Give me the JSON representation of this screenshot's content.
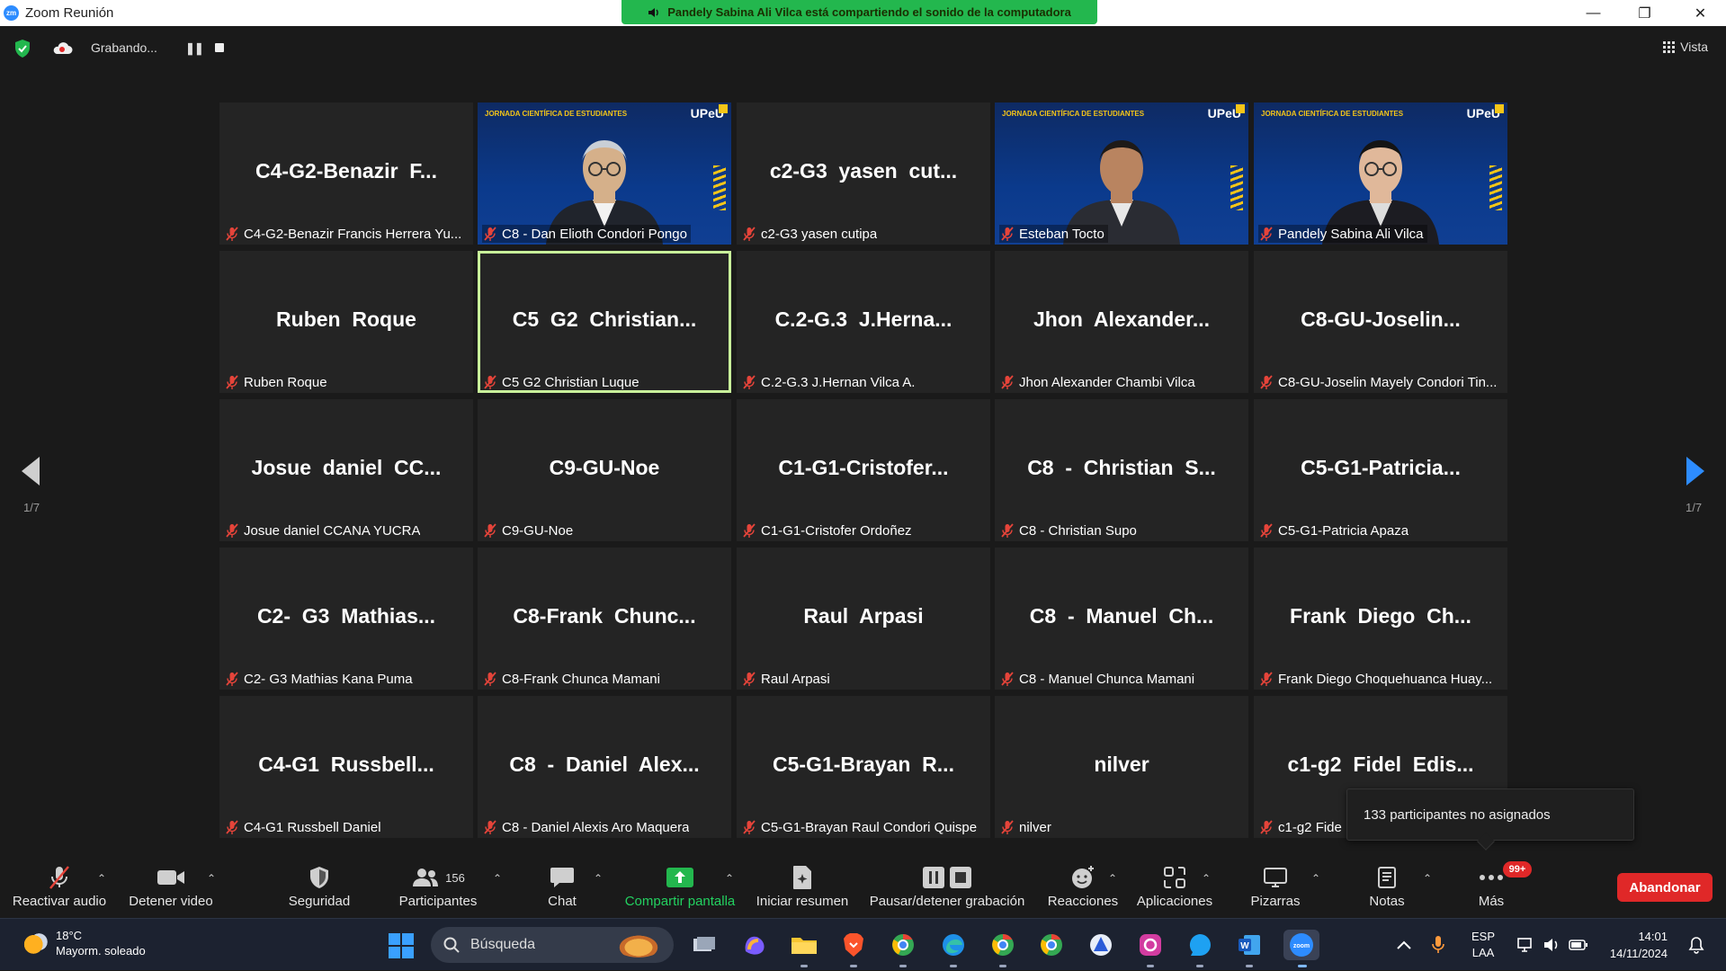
{
  "window": {
    "title": "Zoom Reunión",
    "minimize": "—",
    "restore": "❐",
    "close": "✕"
  },
  "share_banner": {
    "text": "Pandely Sabina Ali Vilca está compartiendo el sonido de la computadora"
  },
  "recording": {
    "label": "Grabando...",
    "pause_glyph": "❚❚",
    "view_label": "Vista"
  },
  "video_header": {
    "event": "JORNADA CIENTÍFICA DE ESTUDIANTES",
    "logo": "UPeU"
  },
  "tiles": [
    {
      "big": "C4-G2-Benazir  F...",
      "label": "C4-G2-Benazir Francis Herrera Yu...",
      "video": false
    },
    {
      "big": "",
      "label": "C8 - Dan Elioth Condori Pongo",
      "video": true
    },
    {
      "big": "c2-G3  yasen  cut...",
      "label": "c2-G3 yasen cutipa",
      "video": false
    },
    {
      "big": "",
      "label": "Esteban Tocto",
      "video": true
    },
    {
      "big": "",
      "label": "Pandely Sabina Ali Vilca",
      "video": true
    },
    {
      "big": "Ruben  Roque",
      "label": "Ruben Roque",
      "video": false
    },
    {
      "big": "C5  G2  Christian...",
      "label": "C5 G2 Christian Luque",
      "video": false,
      "active": true
    },
    {
      "big": "C.2-G.3  J.Herna...",
      "label": "C.2-G.3 J.Hernan Vilca A.",
      "video": false
    },
    {
      "big": "Jhon  Alexander...",
      "label": "Jhon Alexander Chambi Vilca",
      "video": false
    },
    {
      "big": "C8-GU-Joselin...",
      "label": "C8-GU-Joselin Mayely Condori Tin...",
      "video": false
    },
    {
      "big": "Josue  daniel  CC...",
      "label": "Josue daniel CCANA YUCRA",
      "video": false
    },
    {
      "big": "C9-GU-Noe",
      "label": "C9-GU-Noe",
      "video": false
    },
    {
      "big": "C1-G1-Cristofer...",
      "label": "C1-G1-Cristofer Ordoñez",
      "video": false
    },
    {
      "big": "C8  -  Christian  S...",
      "label": "C8 - Christian Supo",
      "video": false
    },
    {
      "big": "C5-G1-Patricia...",
      "label": "C5-G1-Patricia Apaza",
      "video": false
    },
    {
      "big": "C2-  G3  Mathias...",
      "label": "C2- G3 Mathias Kana Puma",
      "video": false
    },
    {
      "big": "C8-Frank  Chunc...",
      "label": "C8-Frank Chunca Mamani",
      "video": false
    },
    {
      "big": "Raul  Arpasi",
      "label": "Raul Arpasi",
      "video": false
    },
    {
      "big": "C8  -  Manuel  Ch...",
      "label": "C8 - Manuel Chunca Mamani",
      "video": false
    },
    {
      "big": "Frank  Diego  Ch...",
      "label": "Frank Diego Choquehuanca Huay...",
      "video": false
    },
    {
      "big": "C4-G1  Russbell...",
      "label": "C4-G1 Russbell Daniel",
      "video": false
    },
    {
      "big": "C8  -  Daniel  Alex...",
      "label": "C8 - Daniel Alexis Aro Maquera",
      "video": false
    },
    {
      "big": "C5-G1-Brayan  R...",
      "label": "C5-G1-Brayan Raul Condori Quispe",
      "video": false
    },
    {
      "big": "nilver",
      "label": "nilver",
      "video": false
    },
    {
      "big": "c1-g2  Fidel  Edis...",
      "label": "c1-g2 Fide",
      "video": false
    }
  ],
  "pagination": {
    "left": "1/7",
    "right": "1/7"
  },
  "tooltip": {
    "text": "133 participantes no asignados"
  },
  "toolbar": {
    "audio": "Reactivar audio",
    "video": "Detener video",
    "security": "Seguridad",
    "participants": "Participantes",
    "participants_count": "156",
    "chat": "Chat",
    "share": "Compartir pantalla",
    "summary": "Iniciar resumen",
    "record": "Pausar/detener grabación",
    "reactions": "Reacciones",
    "apps": "Aplicaciones",
    "whiteboards": "Pizarras",
    "notes": "Notas",
    "more": "Más",
    "more_badge": "99+",
    "leave": "Abandonar"
  },
  "taskbar": {
    "temp": "18°C",
    "weather": "Mayorm. soleado",
    "search": "Búsqueda",
    "lang1": "ESP",
    "lang2": "LAA",
    "time": "14:01",
    "date": "14/11/2024"
  },
  "colors": {
    "accent_green": "#23b74e",
    "leave_red": "#e02828",
    "active_border": "#c8f09a",
    "mic_muted": "#e5443a"
  }
}
